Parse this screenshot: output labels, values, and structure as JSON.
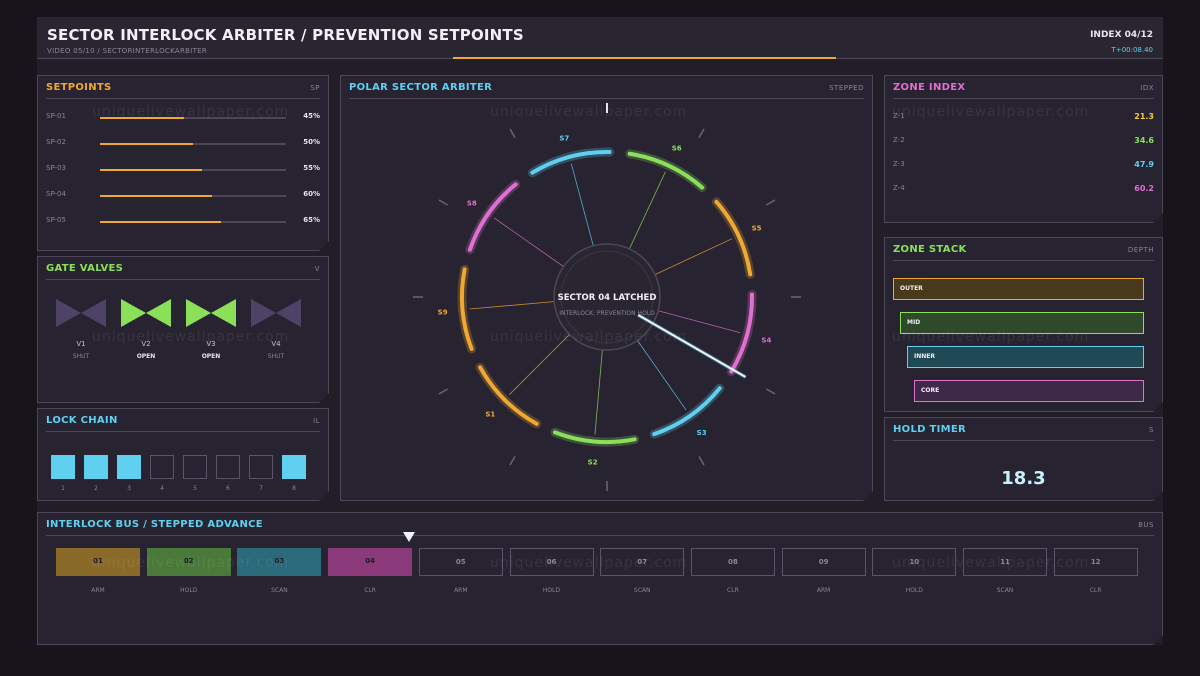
{
  "header": {
    "title": "SECTOR INTERLOCK ARBITER / PREVENTION SETPOINTS",
    "subtitle": "VIDEO 05/10 / SECTORINTERLOCKARBITER",
    "index": "INDEX 04/12",
    "time": "T+00:08.40",
    "progress": 0.34
  },
  "setpoints": {
    "title": "SETPOINTS",
    "tag": "SP",
    "items": [
      {
        "label": "SP-01",
        "value": "45%",
        "fraction": 0.45
      },
      {
        "label": "SP-02",
        "value": "50%",
        "fraction": 0.5
      },
      {
        "label": "SP-03",
        "value": "55%",
        "fraction": 0.55
      },
      {
        "label": "SP-04",
        "value": "60%",
        "fraction": 0.6
      },
      {
        "label": "SP-05",
        "value": "65%",
        "fraction": 0.65
      }
    ]
  },
  "gate_valves": {
    "title": "GATE VALVES",
    "tag": "V",
    "items": [
      {
        "label": "V1",
        "state": "SHUT",
        "open": false
      },
      {
        "label": "V2",
        "state": "OPEN",
        "open": true
      },
      {
        "label": "V3",
        "state": "OPEN",
        "open": true
      },
      {
        "label": "V4",
        "state": "SHUT",
        "open": false
      }
    ]
  },
  "lock_chain": {
    "title": "LOCK CHAIN",
    "tag": "IL",
    "items": [
      {
        "num": "1",
        "on": true
      },
      {
        "num": "2",
        "on": true
      },
      {
        "num": "3",
        "on": true
      },
      {
        "num": "4",
        "on": false
      },
      {
        "num": "5",
        "on": false
      },
      {
        "num": "6",
        "on": false
      },
      {
        "num": "7",
        "on": false
      },
      {
        "num": "8",
        "on": true
      }
    ]
  },
  "polar": {
    "title": "POLAR SECTOR ARBITER",
    "tag": "STEPPED",
    "center_title": "SECTOR 04 LATCHED",
    "center_sub": "INTERLOCK: PREVENTION HOLD",
    "sectors": [
      {
        "label": "S1",
        "color": "#f0a830"
      },
      {
        "label": "S2",
        "color": "#8be05a"
      },
      {
        "label": "S3",
        "color": "#5fd0f0"
      },
      {
        "label": "S4",
        "color": "#e070d0"
      },
      {
        "label": "S5",
        "color": "#f0a830"
      },
      {
        "label": "S6",
        "color": "#8be05a"
      },
      {
        "label": "S7",
        "color": "#5fd0f0"
      },
      {
        "label": "S8",
        "color": "#e070d0"
      },
      {
        "label": "S9",
        "color": "#f0a830"
      }
    ]
  },
  "zone_index": {
    "title": "ZONE INDEX",
    "tag": "IDX",
    "items": [
      {
        "label": "Z-1",
        "value": "21.3",
        "color": "#f0d040"
      },
      {
        "label": "Z-2",
        "value": "34.6",
        "color": "#8be05a"
      },
      {
        "label": "Z-3",
        "value": "47.9",
        "color": "#5fd0f0"
      },
      {
        "label": "Z-4",
        "value": "60.2",
        "color": "#e070d0"
      }
    ]
  },
  "zone_stack": {
    "title": "ZONE STACK",
    "tag": "DEPTH",
    "items": [
      {
        "label": "OUTER",
        "color": "#f0a830",
        "fill": "#4a3a1c"
      },
      {
        "label": "MID",
        "color": "#8be05a",
        "fill": "#2f4a2a"
      },
      {
        "label": "INNER",
        "color": "#5fd0f0",
        "fill": "#1f4a55"
      },
      {
        "label": "CORE",
        "color": "#e070d0",
        "fill": "#3e2a48"
      }
    ]
  },
  "hold_timer": {
    "title": "HOLD TIMER",
    "tag": "S",
    "value": "18.3"
  },
  "bus": {
    "title": "INTERLOCK BUS / STEPPED ADVANCE",
    "tag": "BUS",
    "cells": [
      {
        "num": "01",
        "label": "ARM",
        "fill": "#8a6a28"
      },
      {
        "num": "02",
        "label": "HOLD",
        "fill": "#4a7a3a"
      },
      {
        "num": "03",
        "label": "SCAN",
        "fill": "#2a6a7a"
      },
      {
        "num": "04",
        "label": "CLR",
        "fill": "#8a3a7a"
      },
      {
        "num": "05",
        "label": "ARM",
        "fill": ""
      },
      {
        "num": "06",
        "label": "HOLD",
        "fill": ""
      },
      {
        "num": "07",
        "label": "SCAN",
        "fill": ""
      },
      {
        "num": "08",
        "label": "CLR",
        "fill": ""
      },
      {
        "num": "09",
        "label": "ARM",
        "fill": ""
      },
      {
        "num": "10",
        "label": "HOLD",
        "fill": ""
      },
      {
        "num": "11",
        "label": "SCAN",
        "fill": ""
      },
      {
        "num": "12",
        "label": "CLR",
        "fill": ""
      }
    ]
  },
  "watermark": "uniquelivewallpaper.com",
  "colors": {
    "accent_orange": "#f0a830",
    "accent_cyan": "#5fd0f0",
    "accent_green": "#8be05a",
    "accent_pink": "#e070d0"
  }
}
